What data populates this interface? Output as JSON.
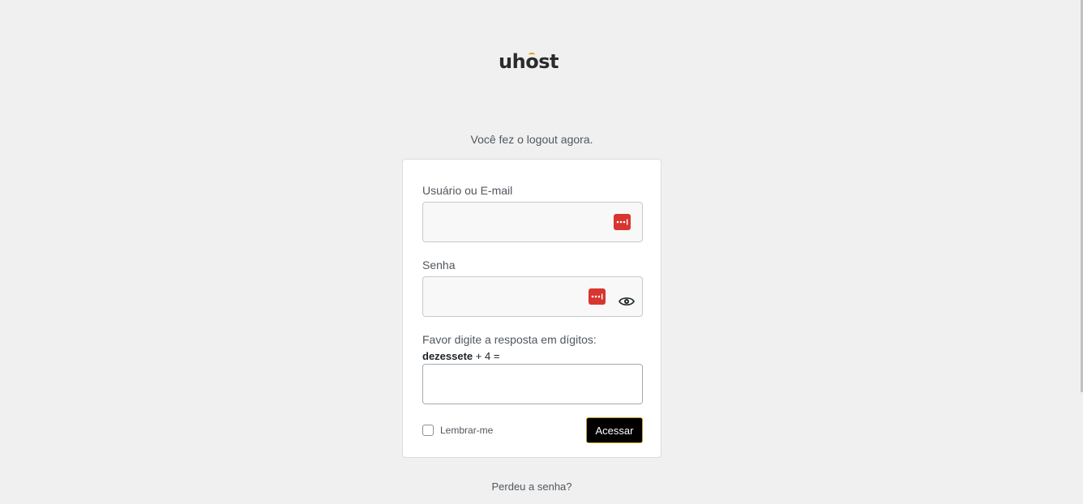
{
  "logo": {
    "text_before": "uh",
    "text_o": "o",
    "text_after": "st"
  },
  "message": "Você fez o logout agora.",
  "form": {
    "username_label": "Usuário ou E-mail",
    "username_value": "",
    "password_label": "Senha",
    "password_value": "",
    "captcha_prompt": "Favor digite a resposta em dígitos:",
    "captcha_word": "dezessete",
    "captcha_rest": " + 4 =",
    "captcha_value": "",
    "remember_label": "Lembrar-me",
    "remember_checked": false,
    "submit_label": "Acessar"
  },
  "lost_password_link": "Perdeu a senha?",
  "colors": {
    "background": "#f0f0f0",
    "password_manager_icon": "#d9352f",
    "button": "#000000",
    "button_border": "#c9a227",
    "logo_accent": "#d9a400"
  },
  "icons": {
    "password_manager": "password-manager-icon",
    "show_password": "eye-icon"
  }
}
